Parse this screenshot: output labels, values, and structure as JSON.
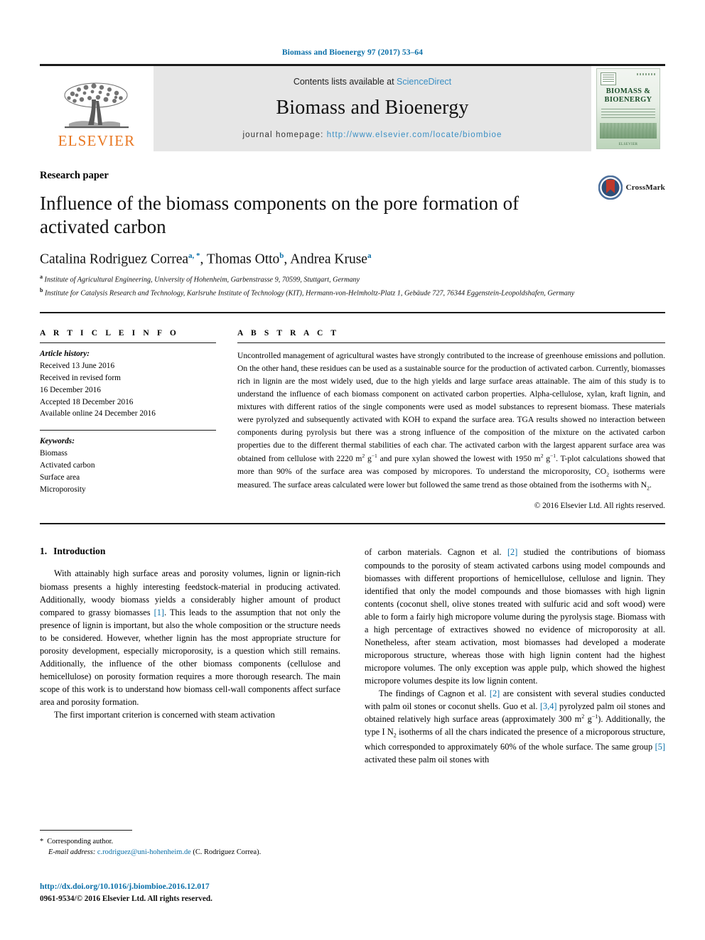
{
  "running_head": "Biomass and Bioenergy 97 (2017) 53–64",
  "banner": {
    "publisher_logo_text": "ELSEVIER",
    "contents_prefix": "Contents lists available at ",
    "contents_link": "ScienceDirect",
    "journal_title": "Biomass and Bioenergy",
    "homepage_prefix": "journal homepage: ",
    "homepage_url": "http://www.elsevier.com/locate/biombioe",
    "cover": {
      "title_line1": "BIOMASS &",
      "title_line2": "BIOENERGY",
      "footer": "ELSEVIER"
    },
    "link_color": "#3a8fc4",
    "background": "#e6e6e6"
  },
  "article": {
    "section_type": "Research paper",
    "title": "Influence of the biomass components on the pore formation of activated carbon",
    "crossmark_label": "CrossMark",
    "authors": [
      {
        "name": "Catalina Rodriguez Correa",
        "marks": "a, *"
      },
      {
        "name": "Thomas Otto",
        "marks": "b"
      },
      {
        "name": "Andrea Kruse",
        "marks": "a"
      }
    ],
    "authors_line_plain": "Catalina Rodriguez Correa a, *, Thomas Otto b, Andrea Kruse a",
    "affiliations": [
      {
        "mark": "a",
        "text": "Institute of Agricultural Engineering, University of Hohenheim, Garbenstrasse 9, 70599, Stuttgart, Germany"
      },
      {
        "mark": "b",
        "text": "Institute for Catalysis Research and Technology, Karlsruhe Institute of Technology (KIT), Hermann-von-Helmholtz-Platz 1, Gebäude 727, 76344 Eggenstein-Leopoldshafen, Germany"
      }
    ]
  },
  "article_info": {
    "heading": "A R T I C L E   I N F O",
    "history_label": "Article history:",
    "history": [
      "Received 13 June 2016",
      "Received in revised form",
      "16 December 2016",
      "Accepted 18 December 2016",
      "Available online 24 December 2016"
    ],
    "keywords_label": "Keywords:",
    "keywords": [
      "Biomass",
      "Activated carbon",
      "Surface area",
      "Microporosity"
    ]
  },
  "abstract": {
    "heading": "A B S T R A C T",
    "text_part1": "Uncontrolled management of agricultural wastes have strongly contributed to the increase of greenhouse emissions and pollution. On the other hand, these residues can be used as a sustainable source for the production of activated carbon. Currently, biomasses rich in lignin are the most widely used, due to the high yields and large surface areas attainable. The aim of this study is to understand the influence of each biomass component on activated carbon properties. Alpha-cellulose, xylan, kraft lignin, and mixtures with different ratios of the single components were used as model substances to represent biomass. These materials were pyrolyzed and subsequently activated with KOH to expand the surface area. TGA results showed no interaction between components during pyrolysis but there was a strong influence of the composition of the mixture on the activated carbon properties due to the different thermal stabilities of each char. The activated carbon with the largest apparent surface area was obtained from cellulose with 2220 m",
    "unit1_sup": "2",
    "text_part2": " g",
    "unit2_sup": "−1",
    "text_part3": " and pure xylan showed the lowest with 1950 m",
    "unit3_sup": "2",
    "text_part4": " g",
    "unit4_sup": "−1",
    "text_part5": ". T-plot calculations showed that more than 90% of the surface area was composed by micropores. To understand the microporosity, CO",
    "co2_sub": "2",
    "text_part6": " isotherms were measured. The surface areas calculated were lower but followed the same trend as those obtained from the isotherms with N",
    "n2_sub": "2",
    "text_part7": ".",
    "copyright": "© 2016 Elsevier Ltd. All rights reserved."
  },
  "body": {
    "left_column": {
      "section_number": "1.",
      "section_title": "Introduction",
      "paragraph1_a": "With attainably high surface areas and porosity volumes, lignin or lignin-rich biomass presents a highly interesting feedstock-material in producing activated. Additionally, woody biomass yields a considerably higher amount of product compared to grassy biomasses ",
      "paragraph1_ref": "[1]",
      "paragraph1_b": ". This leads to the assumption that not only the presence of lignin is important, but also the whole composition or the structure needs to be considered. However, whether lignin has the most appropriate structure for porosity development, especially microporosity, is a question which still remains. Additionally, the influence of the other biomass components (cellulose and hemicellulose) on porosity formation requires a more thorough research. The main scope of this work is to understand how biomass cell-wall components affect surface area and porosity formation.",
      "paragraph2": "The first important criterion is concerned with steam activation"
    },
    "right_column": {
      "paragraph1_a": "of carbon materials. Cagnon et al. ",
      "paragraph1_ref": "[2]",
      "paragraph1_b": " studied the contributions of biomass compounds to the porosity of steam activated carbons using model compounds and biomasses with different proportions of hemicellulose, cellulose and lignin. They identified that only the model compounds and those biomasses with high lignin contents (coconut shell, olive stones treated with sulfuric acid and soft wood) were able to form a fairly high micropore volume during the pyrolysis stage. Biomass with a high percentage of extractives showed no evidence of microporosity at all. Nonetheless, after steam activation, most biomasses had developed a moderate microporous structure, whereas those with high lignin content had the highest micropore volumes. The only exception was apple pulp, which showed the highest micropore volumes despite its low lignin content.",
      "paragraph2_a": "The findings of Cagnon et al. ",
      "paragraph2_ref1": "[2]",
      "paragraph2_b": " are consistent with several studies conducted with palm oil stones or coconut shells. Guo et al. ",
      "paragraph2_ref2": "[3,4]",
      "paragraph2_c": " pyrolyzed palm oil stones and obtained relatively high surface areas (approximately 300 m",
      "unit_sup1": "2",
      "paragraph2_d": " g",
      "unit_sup2": "−1",
      "paragraph2_e": "). Additionally, the type I N",
      "n2_sub": "2",
      "paragraph2_f": " isotherms of all the chars indicated the presence of a microporous structure, which corresponded to approximately 60% of the whole surface. The same group ",
      "paragraph2_ref3": "[5]",
      "paragraph2_g": " activated these palm oil stones with"
    }
  },
  "footnote": {
    "star": "*",
    "corresponding": "Corresponding author.",
    "email_label": "E-mail address:",
    "email": "c.rodriguez@uni-hohenheim.de",
    "email_suffix": "(C. Rodriguez Correa).",
    "doi_url": "http://dx.doi.org/10.1016/j.biombioe.2016.12.017",
    "issn_line": "0961-9534/© 2016 Elsevier Ltd. All rights reserved."
  },
  "colors": {
    "link": "#0a6fa8",
    "accent_orange": "#e87722",
    "banner_gray": "#e6e6e6"
  }
}
